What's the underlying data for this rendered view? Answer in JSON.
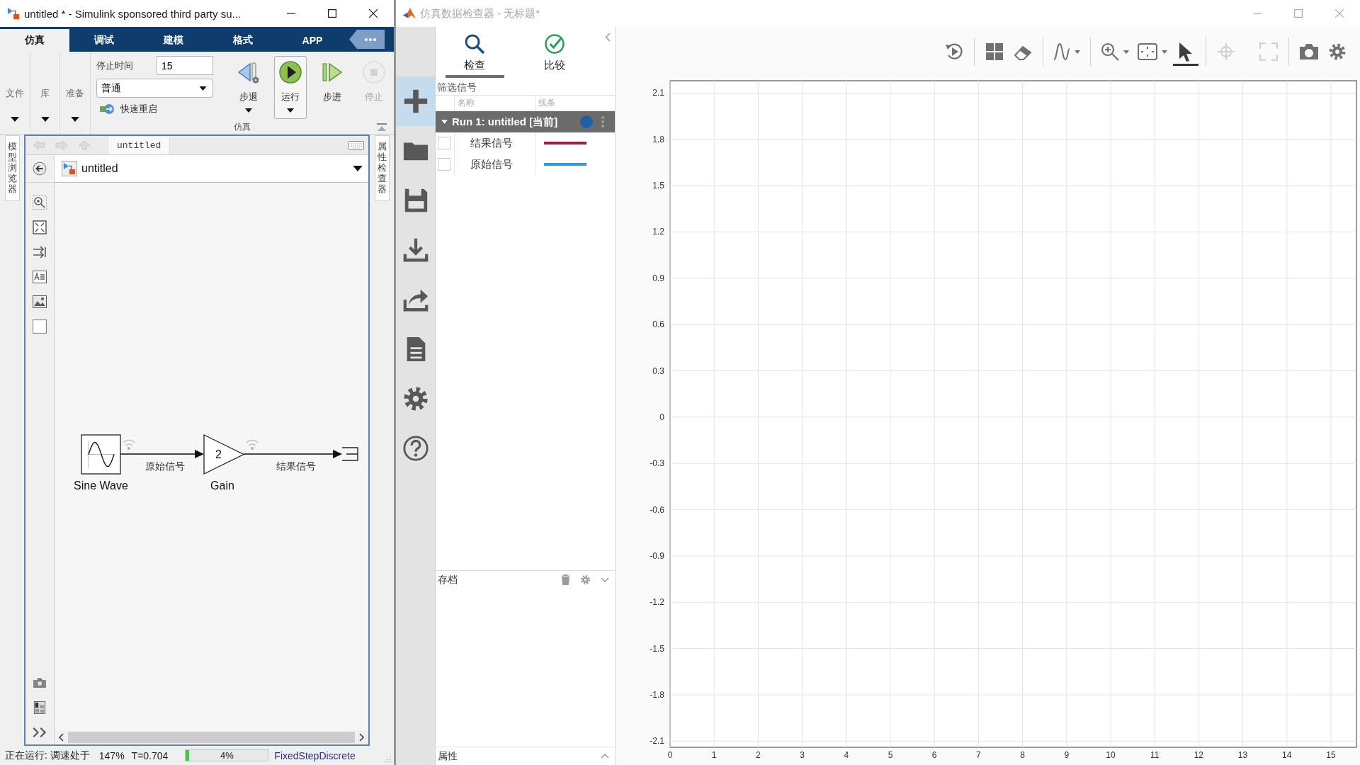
{
  "simulink_window": {
    "title": "untitled * - Simulink sponsored third party su...",
    "active": true,
    "tabs": [
      {
        "label": "仿真",
        "selected": true
      },
      {
        "label": "调试",
        "selected": false
      },
      {
        "label": "建模",
        "selected": false
      },
      {
        "label": "格式",
        "selected": false
      },
      {
        "label": "APP",
        "selected": false
      }
    ],
    "ribbon": {
      "menus": [
        "文件",
        "库",
        "准备"
      ],
      "stop_time": {
        "label": "停止时间",
        "value": "15"
      },
      "mode": {
        "value": "普通"
      },
      "fast_restart": {
        "label": "快速重启"
      },
      "buttons": [
        {
          "kind": "step_back",
          "label": "步退",
          "has_menu": true,
          "disabled": false,
          "highlighted": false
        },
        {
          "kind": "run",
          "label": "运行",
          "has_menu": true,
          "disabled": false,
          "highlighted": true
        },
        {
          "kind": "step_forward",
          "label": "步进",
          "has_menu": false,
          "disabled": false,
          "highlighted": false
        },
        {
          "kind": "stop",
          "label": "停止",
          "has_menu": false,
          "disabled": true,
          "highlighted": false
        }
      ],
      "group_label": "仿真"
    },
    "side_panels": {
      "left": "模型浏览器",
      "right": "属性检查器"
    },
    "editor": {
      "breadcrumb": "untitled",
      "address": "untitled",
      "blocks": [
        {
          "kind": "sine_wave",
          "label": "Sine Wave"
        },
        {
          "kind": "gain",
          "label": "Gain",
          "value": "2"
        },
        {
          "kind": "outport"
        }
      ],
      "signals": [
        {
          "label": "原始信号",
          "logged": true
        },
        {
          "label": "结果信号",
          "logged": true
        }
      ]
    },
    "status_bar": {
      "message": "正在运行: 调速处于",
      "pacing": "147%",
      "time": "T=0.704",
      "progress": {
        "level": 0.04,
        "reading": "4%"
      },
      "solver": "FixedStepDiscrete"
    }
  },
  "sdi_window": {
    "title": "仿真数据检查器 - 无标题*",
    "active": false,
    "sidebar": [
      {
        "kind": "add",
        "highlighted": true
      },
      {
        "kind": "open",
        "highlighted": false
      },
      {
        "kind": "save",
        "highlighted": false
      },
      {
        "kind": "import",
        "highlighted": false
      },
      {
        "kind": "export",
        "highlighted": false
      },
      {
        "kind": "report",
        "highlighted": false
      },
      {
        "kind": "settings",
        "highlighted": false
      },
      {
        "kind": "help",
        "highlighted": false
      }
    ],
    "tabs": [
      {
        "kind": "inspect",
        "label": "检查",
        "selected": true
      },
      {
        "kind": "compare",
        "label": "比较",
        "selected": false
      }
    ],
    "filter": {
      "placeholder": "筛选信号"
    },
    "columns": [
      "名称",
      "线条"
    ],
    "runs": [
      {
        "name": "Run 1: untitled [当前]",
        "expanded": true,
        "color": "#1f5fa8",
        "signals": [
          {
            "name": "结果信号",
            "checked": false,
            "color": "#a01f3d"
          },
          {
            "name": "原始信号",
            "checked": false,
            "color": "#2b9be3"
          }
        ]
      }
    ],
    "archive": {
      "label": "存档"
    },
    "properties": {
      "label": "属性"
    },
    "toolbar": [
      {
        "kind": "replay",
        "selected": false,
        "disabled": false
      },
      {
        "kind": "layout",
        "selected": false,
        "disabled": false
      },
      {
        "kind": "clear",
        "selected": false,
        "disabled": false
      },
      {
        "kind": "line_style",
        "selected": false,
        "disabled": false,
        "has_menu": true
      },
      {
        "kind": "zoom",
        "selected": false,
        "disabled": false,
        "has_menu": true
      },
      {
        "kind": "fit",
        "selected": false,
        "disabled": false,
        "has_menu": true
      },
      {
        "kind": "cursor",
        "selected": true,
        "disabled": false
      },
      {
        "kind": "data_cursor",
        "selected": false,
        "disabled": true
      },
      {
        "kind": "full_screen",
        "selected": false,
        "disabled": true
      },
      {
        "kind": "snapshot",
        "selected": false,
        "disabled": false
      },
      {
        "kind": "settings",
        "selected": false,
        "disabled": false
      }
    ],
    "chart_data": {
      "type": "line",
      "grid": true,
      "xlim": [
        0,
        15.58
      ],
      "ylim": [
        -2.14,
        2.18
      ],
      "xticks": [
        0,
        1,
        2,
        3,
        4,
        5,
        6,
        7,
        8,
        9,
        10,
        11,
        12,
        13,
        14,
        15
      ],
      "yticks": [
        -2.1,
        -1.8,
        -1.5,
        -1.2,
        -0.9,
        -0.6,
        -0.3,
        0,
        0.3,
        0.6,
        0.9,
        1.2,
        1.5,
        1.8,
        2.1
      ]
    }
  }
}
